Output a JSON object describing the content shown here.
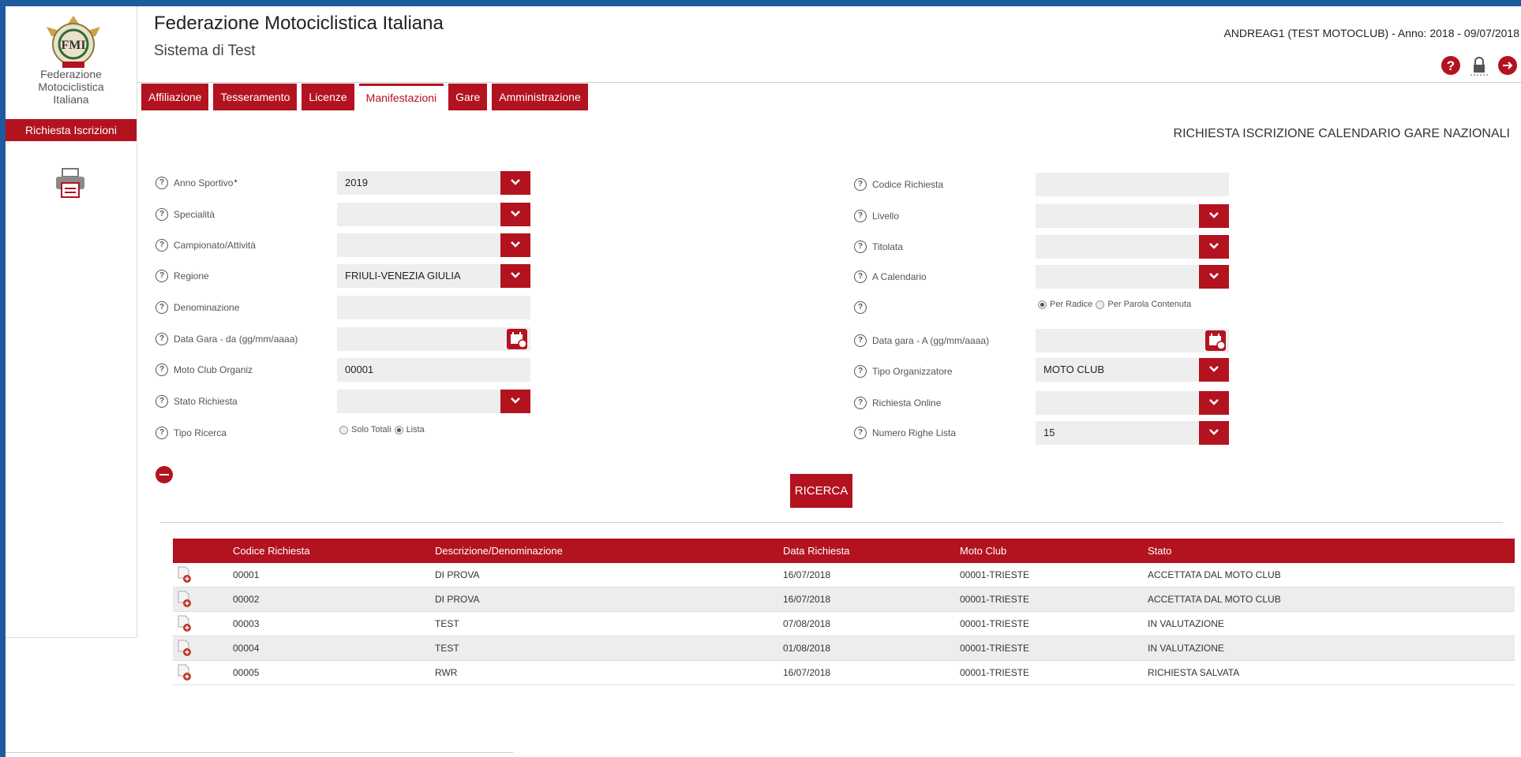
{
  "app": {
    "title": "Federazione Motociclistica Italiana",
    "subtitle": "Sistema di Test",
    "user_info": "ANDREAG1 (TEST MOTOCLUB) - Anno: 2018 - 09/07/2018"
  },
  "sidebar": {
    "org_lines": [
      "Federazione",
      "Motociclistica",
      "Italiana"
    ],
    "logo_text": "FMI",
    "active_item": "Richiesta Iscrizioni"
  },
  "tabs": [
    {
      "label": "Affiliazione",
      "active": false
    },
    {
      "label": "Tesseramento",
      "active": false
    },
    {
      "label": "Licenze",
      "active": false
    },
    {
      "label": "Manifestazioni",
      "active": true
    },
    {
      "label": "Gare",
      "active": false
    },
    {
      "label": "Amministrazione",
      "active": false
    }
  ],
  "page_heading": "RICHIESTA ISCRIZIONE CALENDARIO GARE NAZIONALI",
  "form": {
    "left": [
      {
        "label": "Anno Sportivo",
        "required": "*",
        "value": "2019",
        "type": "select"
      },
      {
        "label": "Specialità",
        "value": "",
        "type": "select"
      },
      {
        "label": "Campionato/Attività",
        "value": "",
        "type": "select"
      },
      {
        "label": "Regione",
        "value": "FRIULI-VENEZIA GIULIA",
        "type": "select"
      },
      {
        "label": "Denominazione",
        "value": "",
        "type": "text"
      },
      {
        "label": "Data Gara - da (gg/mm/aaaa)",
        "value": "",
        "type": "date"
      },
      {
        "label": "Moto Club Organiz",
        "value": "00001",
        "type": "text"
      },
      {
        "label": "Stato Richiesta",
        "value": "",
        "type": "select"
      },
      {
        "label": "Tipo Ricerca",
        "type": "radio"
      }
    ],
    "right": [
      {
        "label": "Codice Richiesta",
        "value": "",
        "type": "text"
      },
      {
        "label": "Livello",
        "value": "",
        "type": "select"
      },
      {
        "label": "Titolata",
        "value": "",
        "type": "select"
      },
      {
        "label": "A Calendario",
        "value": "",
        "type": "select"
      },
      {
        "label": "",
        "type": "radio"
      },
      {
        "label": "Data gara - A (gg/mm/aaaa)",
        "value": "",
        "type": "date"
      },
      {
        "label": "Tipo Organizzatore",
        "value": "MOTO CLUB",
        "type": "select"
      },
      {
        "label": "Richiesta Online",
        "value": "",
        "type": "select"
      },
      {
        "label": "Numero Righe Lista",
        "value": "15",
        "type": "select"
      }
    ],
    "tipo_ricerca_options": [
      {
        "label": "Solo Totali",
        "checked": false
      },
      {
        "label": "Lista",
        "checked": true
      }
    ],
    "match_options": [
      {
        "label": "Per Radice",
        "checked": true
      },
      {
        "label": "Per Parola Contenuta",
        "checked": false
      }
    ],
    "search_button": "RICERCA"
  },
  "table": {
    "columns": [
      "",
      "Codice Richiesta",
      "Descrizione/Denominazione",
      "Data Richiesta",
      "Moto Club",
      "Stato"
    ],
    "rows": [
      [
        "00001",
        "DI PROVA",
        "16/07/2018",
        "00001-TRIESTE",
        "ACCETTATA DAL MOTO CLUB"
      ],
      [
        "00002",
        "DI PROVA",
        "16/07/2018",
        "00001-TRIESTE",
        "ACCETTATA DAL MOTO CLUB"
      ],
      [
        "00003",
        "TEST",
        "07/08/2018",
        "00001-TRIESTE",
        "IN VALUTAZIONE"
      ],
      [
        "00004",
        "TEST",
        "01/08/2018",
        "00001-TRIESTE",
        "IN VALUTAZIONE"
      ],
      [
        "00005",
        "RWR",
        "16/07/2018",
        "00001-TRIESTE",
        "RICHIESTA SALVATA"
      ]
    ]
  },
  "colors": {
    "accent": "#b3131f",
    "frame": "#1f5a9e",
    "field_bg": "#eeeeee"
  }
}
